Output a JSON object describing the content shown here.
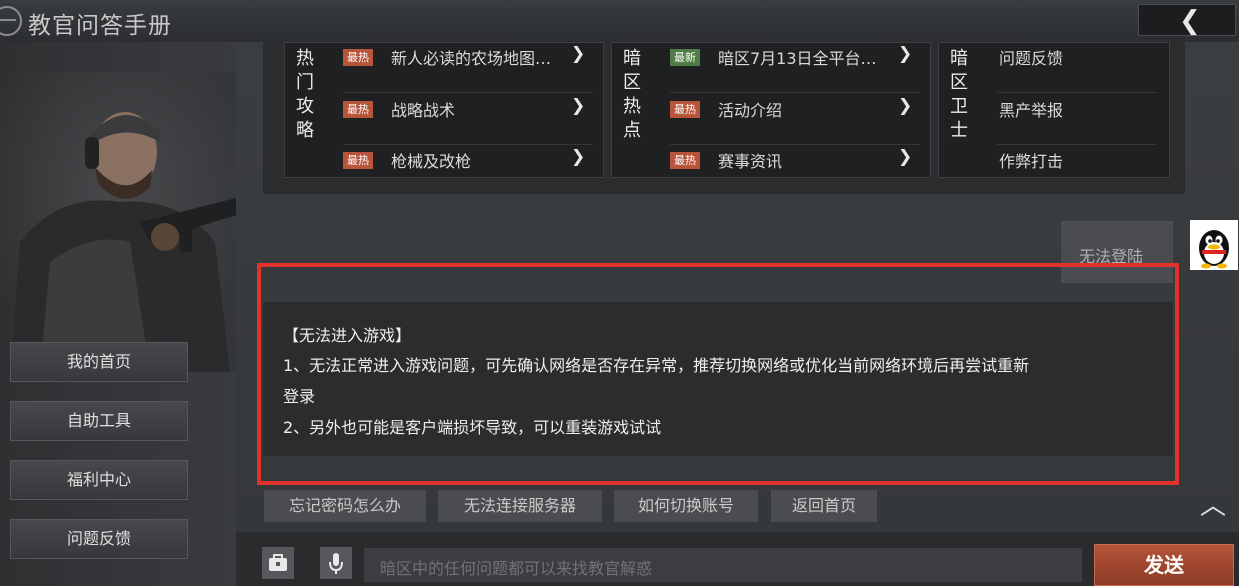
{
  "header": {
    "title": "教官问答手册",
    "back_icon": "chevron-left-icon"
  },
  "sidebar": {
    "items": [
      {
        "label": "我的首页"
      },
      {
        "label": "自助工具"
      },
      {
        "label": "福利中心"
      },
      {
        "label": "问题反馈"
      }
    ]
  },
  "categories": [
    {
      "label": "热门攻略",
      "items": [
        {
          "tag": "最热",
          "tag_type": "hot",
          "label": "新人必读的农场地图…"
        },
        {
          "tag": "最热",
          "tag_type": "hot",
          "label": "战略战术"
        },
        {
          "tag": "最热",
          "tag_type": "hot",
          "label": "枪械及改枪"
        }
      ]
    },
    {
      "label": "暗区热点",
      "items": [
        {
          "tag": "最新",
          "tag_type": "new",
          "label": "暗区7月13日全平台…"
        },
        {
          "tag": "最热",
          "tag_type": "hot",
          "label": "活动介绍"
        },
        {
          "tag": "最热",
          "tag_type": "hot",
          "label": "赛事资讯"
        }
      ]
    },
    {
      "label": "暗区卫士",
      "items": [
        {
          "label": "问题反馈"
        },
        {
          "label": "黑产举报"
        },
        {
          "label": "作弊打击"
        }
      ]
    }
  ],
  "chat": {
    "user_message": "无法登陆",
    "answer": {
      "title": "【无法进入游戏】",
      "line1": "1、无法正常进入游戏问题，可先确认网络是否存在异常，推荐切换网络或优化当前网络环境后再尝试重新",
      "line1_cont": "登录",
      "line2": "2、另外也可能是客户端损坏导致，可以重装游戏试试"
    }
  },
  "quick_replies": [
    "忘记密码怎么办",
    "无法连接服务器",
    "如何切换账号",
    "返回首页"
  ],
  "input": {
    "placeholder": "暗区中的任何问题都可以来找教官解惑"
  },
  "send_label": "发送",
  "colors": {
    "accent": "#b5543a",
    "highlight_box": "#e2322c",
    "tag_new": "#4f7d45"
  }
}
